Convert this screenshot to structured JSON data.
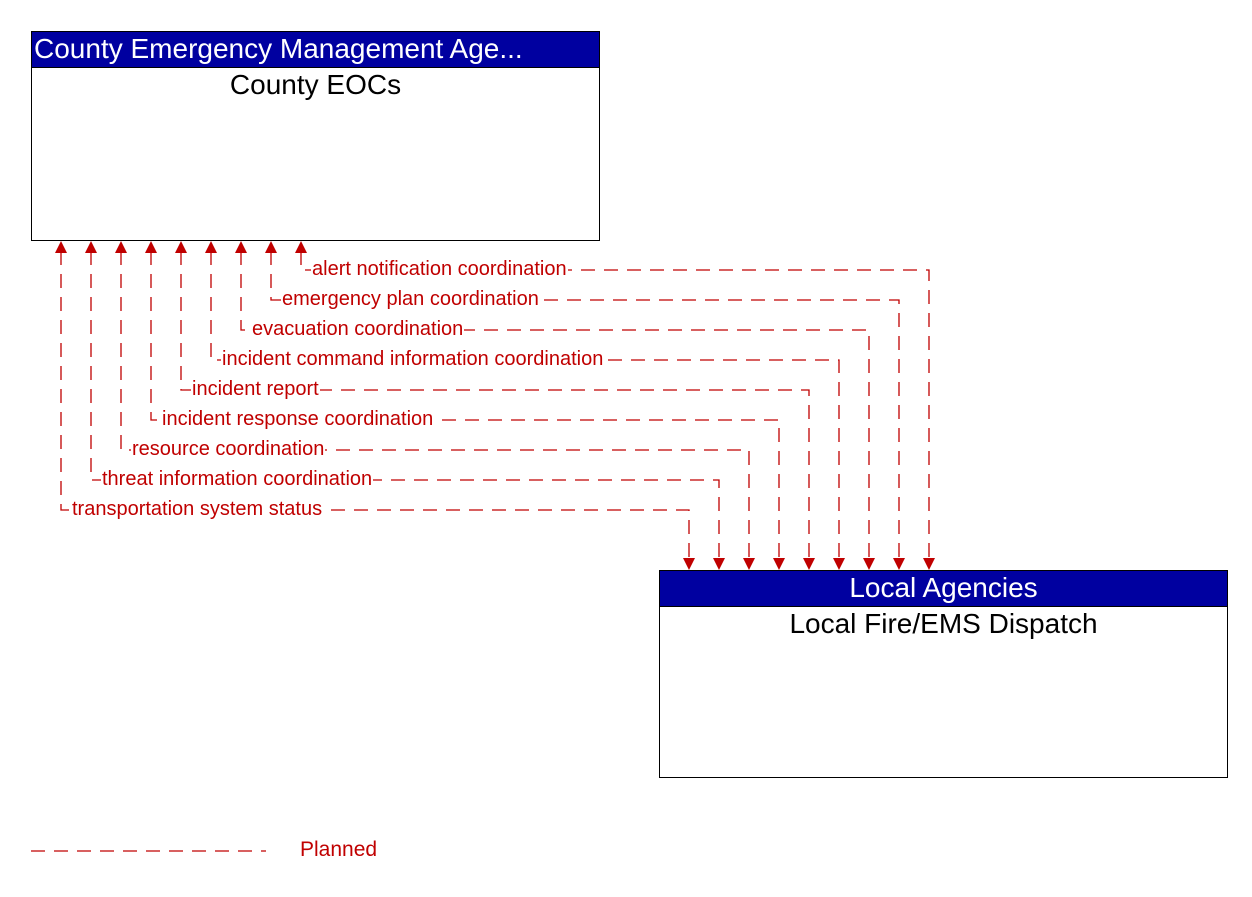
{
  "diagram": {
    "source_node": {
      "header": "County Emergency Management Age...",
      "title": "County EOCs"
    },
    "target_node": {
      "header": "Local Agencies",
      "title": "Local Fire/EMS Dispatch"
    },
    "flows": [
      {
        "label": "alert notification coordination",
        "status": "Planned"
      },
      {
        "label": "emergency plan coordination",
        "status": "Planned"
      },
      {
        "label": "evacuation coordination",
        "status": "Planned"
      },
      {
        "label": "incident command information coordination",
        "status": "Planned"
      },
      {
        "label": "incident report",
        "status": "Planned"
      },
      {
        "label": "incident response coordination",
        "status": "Planned"
      },
      {
        "label": "resource coordination",
        "status": "Planned"
      },
      {
        "label": "threat information coordination",
        "status": "Planned"
      },
      {
        "label": "transportation system status",
        "status": "Planned"
      }
    ],
    "flow_direction": "bidirectional",
    "flow_color": "#c00000",
    "header_color": "#0000a0"
  },
  "legend": {
    "items": [
      {
        "label": "Planned",
        "line_style": "dashed",
        "color": "#c00000"
      }
    ]
  }
}
